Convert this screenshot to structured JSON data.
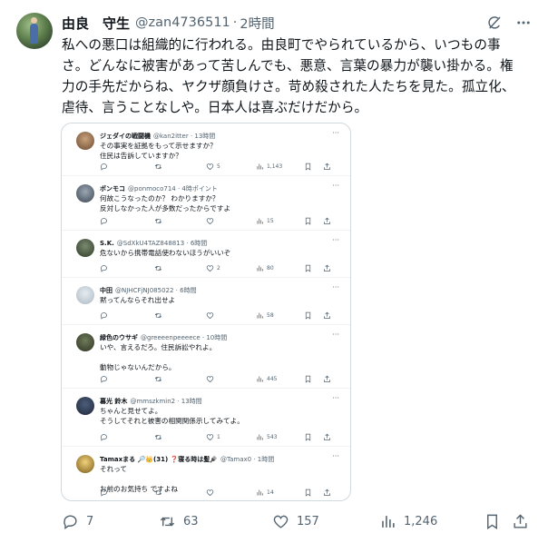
{
  "post": {
    "display_name": "由良　守生",
    "handle": "@zan4736511",
    "separator": "·",
    "time": "2時間",
    "body_lines": [
      "私への悪口は組織的に行われる。由良町でやられているから、いつもの事",
      "さ。どんなに被害があって苦しんでも、悪意、言葉の暴力が襲い掛かる。権",
      "力の手先だからね、ヤクザ顔負けさ。苛め殺された人たちを見た。孤立化、",
      "虐待、言うことなしや。日本人は喜ぶだけだから。"
    ],
    "icons": {
      "grok": "grok-icon",
      "more": "more-icon"
    }
  },
  "replies": [
    {
      "name": "ジェダイの戦闘機",
      "meta": "@kan2itter · 13時間",
      "lines": [
        "その事実を証拠をもって示せますか？",
        "住民は告訴していますか？"
      ],
      "reply": "",
      "retweet": "",
      "like": "5",
      "views": "1,143"
    },
    {
      "name": "ポンモコ",
      "meta": "@ponmoco714 · 4時ポイント",
      "lines": [
        "何故こうなったのか？ わかりますか？",
        "反対しなかった人が多数だったからですよ"
      ],
      "reply": "",
      "retweet": "",
      "like": "",
      "views": "15"
    },
    {
      "name": "S.K.",
      "meta": "@SdXkU4TAZ848813 · 6時間",
      "lines": [
        "危ないから携帯電話使わないほうがいいぞ"
      ],
      "reply": "",
      "retweet": "",
      "like": "2",
      "views": "80"
    },
    {
      "name": "中田",
      "meta": "@NJHCFjNJ085022 · 6時間",
      "lines": [
        "黙ってんならそれ出せよ"
      ],
      "reply": "",
      "retweet": "",
      "like": "",
      "views": "58"
    },
    {
      "name": "緑色のウサギ",
      "meta": "@greeeenpeeeece · 10時間",
      "lines": [
        "いや、言えるだろ。住民訴訟やれよ。",
        "",
        "動物じゃないんだから。"
      ],
      "reply": "",
      "retweet": "",
      "like": "",
      "views": "445"
    },
    {
      "name": "暮光 鈴木",
      "meta": "@mmszkmin2 · 13時間",
      "lines": [
        "ちゃんと見せてよ。",
        "そうしてそれと被害の相関関係示してみてよ。"
      ],
      "reply": "",
      "retweet": "",
      "like": "1",
      "views": "543"
    },
    {
      "name": "Tamaxまる 🔎👑(31) ❓寝る時は髪🪮",
      "meta": "@Tamax0 · 1時間",
      "lines": [
        "それって",
        "",
        "お前のお気持ち ですよね"
      ],
      "reply": "",
      "retweet": "",
      "like": "",
      "views": "14"
    }
  ],
  "actions": {
    "reply_count": "7",
    "retweet_count": "63",
    "like_count": "157",
    "views_count": "1,246"
  },
  "colors": {
    "text": "#0f1419",
    "muted": "#536471",
    "border": "#cfd9de"
  }
}
